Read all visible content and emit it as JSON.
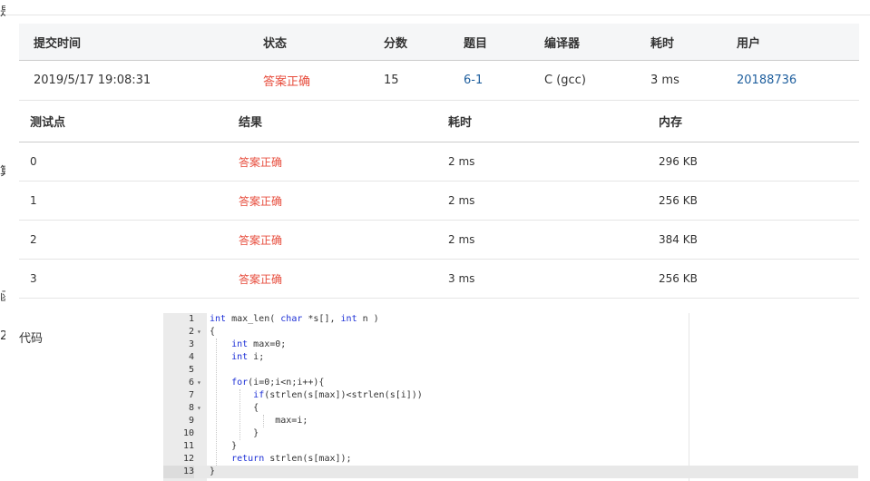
{
  "colors": {
    "accepted": "#e74c3c",
    "link": "#1f5f9e",
    "header_bg": "#f5f6f7",
    "gutter_bg": "#ebebeb"
  },
  "submission": {
    "headers": [
      "提交时间",
      "状态",
      "分数",
      "题目",
      "编译器",
      "耗时",
      "用户"
    ],
    "row": {
      "time": "2019/5/17 19:08:31",
      "status": "答案正确",
      "score": "15",
      "problem": "6-1",
      "compiler": "C (gcc)",
      "duration": "3 ms",
      "user": "20188736"
    }
  },
  "tests": {
    "headers": [
      "测试点",
      "结果",
      "耗时",
      "内存"
    ],
    "rows": [
      {
        "id": "0",
        "result": "答案正确",
        "time": "2 ms",
        "memory": "296 KB"
      },
      {
        "id": "1",
        "result": "答案正确",
        "time": "2 ms",
        "memory": "256 KB"
      },
      {
        "id": "2",
        "result": "答案正确",
        "time": "2 ms",
        "memory": "384 KB"
      },
      {
        "id": "3",
        "result": "答案正确",
        "time": "3 ms",
        "memory": "256 KB"
      }
    ]
  },
  "code": {
    "label": "代码",
    "active_line": 13,
    "lines": [
      {
        "n": "1",
        "text": "int max_len( char *s[], int n )"
      },
      {
        "n": "2",
        "text": "{",
        "fold": "▾"
      },
      {
        "n": "3",
        "text": "    int max=0;"
      },
      {
        "n": "4",
        "text": "    int i;"
      },
      {
        "n": "5",
        "text": ""
      },
      {
        "n": "6",
        "text": "    for(i=0;i<n;i++){",
        "fold": "▾"
      },
      {
        "n": "7",
        "text": "        if(strlen(s[max])<strlen(s[i]))"
      },
      {
        "n": "8",
        "text": "        {",
        "fold": "▾"
      },
      {
        "n": "9",
        "text": "            max=i;"
      },
      {
        "n": "10",
        "text": "        }"
      },
      {
        "n": "11",
        "text": "    }"
      },
      {
        "n": "12",
        "text": "    return strlen(s[max]);"
      },
      {
        "n": "13",
        "text": "}"
      }
    ]
  },
  "edge_glyphs": [
    "是",
    "算",
    "函",
    "2"
  ]
}
